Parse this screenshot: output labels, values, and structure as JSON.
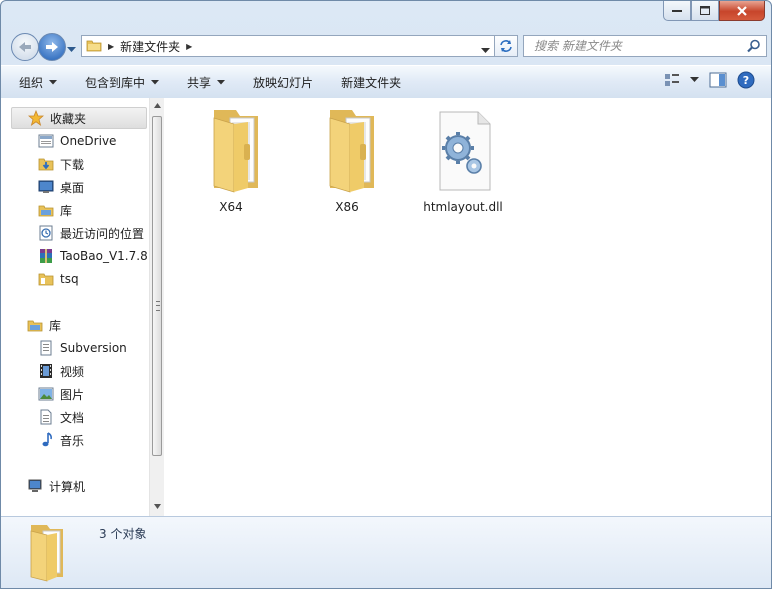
{
  "window": {
    "caption": {
      "minimize": "minimize",
      "maximize": "maximize",
      "close": "close"
    }
  },
  "address": {
    "crumbs": [
      "新建文件夹"
    ],
    "search_placeholder": "搜索 新建文件夹"
  },
  "toolbar": {
    "organize": "组织",
    "include_in_library": "包含到库中",
    "share": "共享",
    "slideshow": "放映幻灯片",
    "new_folder": "新建文件夹"
  },
  "sidebar": {
    "favorites": {
      "label": "收藏夹",
      "items": [
        {
          "label": "OneDrive",
          "icon": "onedrive-icon"
        },
        {
          "label": "下载",
          "icon": "download-folder-icon"
        },
        {
          "label": "桌面",
          "icon": "desktop-icon"
        },
        {
          "label": "库",
          "icon": "library-icon"
        },
        {
          "label": "最近访问的位置",
          "icon": "recent-places-icon"
        },
        {
          "label": "TaoBao_V1.7.8.",
          "icon": "archive-icon"
        },
        {
          "label": "tsq",
          "icon": "folder-icon"
        }
      ]
    },
    "libraries": {
      "label": "库",
      "items": [
        {
          "label": "Subversion",
          "icon": "subversion-icon"
        },
        {
          "label": "视频",
          "icon": "video-icon"
        },
        {
          "label": "图片",
          "icon": "picture-icon"
        },
        {
          "label": "文档",
          "icon": "document-icon"
        },
        {
          "label": "音乐",
          "icon": "music-icon"
        }
      ]
    },
    "computer": {
      "label": "计算机"
    }
  },
  "files": [
    {
      "name": "X64",
      "type": "folder"
    },
    {
      "name": "X86",
      "type": "folder"
    },
    {
      "name": "htmlayout.dll",
      "type": "dll"
    }
  ],
  "details": {
    "count": "3 个对象"
  },
  "colors": {
    "accent": "#1f5fb6",
    "folder": "#f2d47a",
    "close": "#c7452b"
  }
}
